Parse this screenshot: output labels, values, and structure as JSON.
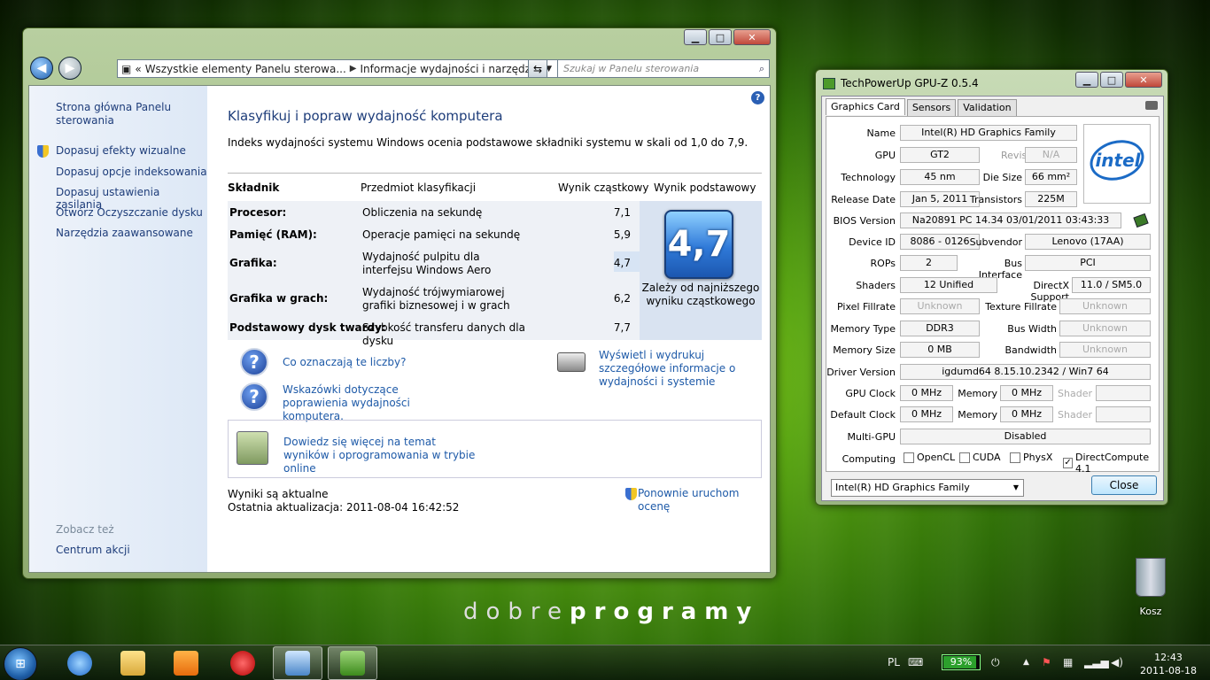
{
  "desktop": {
    "brand_light": "dobre",
    "brand_bold": "programy",
    "recycle_label": "Kosz"
  },
  "cp_window": {
    "address": {
      "prefix": "«",
      "crumb1": "Wszystkie elementy Panelu sterowa...",
      "crumb2": "Informacje wydajności i narzędzia"
    },
    "search_placeholder": "Szukaj w Panelu sterowania",
    "sidebar": {
      "home": "Strona główna Panelu sterowania",
      "items": [
        "Dopasuj efekty wizualne",
        "Dopasuj opcje indeksowania",
        "Dopasuj ustawienia zasilania",
        "Otwórz Oczyszczanie dysku",
        "Narzędzia zaawansowane"
      ],
      "see_also": "Zobacz też",
      "action_center": "Centrum akcji"
    },
    "main": {
      "title": "Klasyfikuj i popraw wydajność komputera",
      "description": "Indeks wydajności systemu Windows ocenia podstawowe składniki systemu w skali od 1,0 do 7,9.",
      "headers": [
        "Składnik",
        "Przedmiot klasyfikacji",
        "Wynik cząstkowy",
        "Wynik podstawowy"
      ],
      "rows": [
        {
          "component": "Procesor:",
          "rated": "Obliczenia na sekundę",
          "score": "7,1"
        },
        {
          "component": "Pamięć (RAM):",
          "rated": "Operacje pamięci na sekundę",
          "score": "5,9"
        },
        {
          "component": "Grafika:",
          "rated": "Wydajność pulpitu dla interfejsu Windows Aero",
          "score": "4,7"
        },
        {
          "component": "Grafika w grach:",
          "rated": "Wydajność trójwymiarowej grafiki biznesowej i w grach",
          "score": "6,2"
        },
        {
          "component": "Podstawowy dysk twardy:",
          "rated": "Szybkość transferu danych dla dysku",
          "score": "7,7"
        }
      ],
      "base_score": "4,7",
      "base_note": "Zależy od najniższego wyniku cząstkowego",
      "link_what": "Co oznaczają te liczby?",
      "link_tips": "Wskazówki dotyczące poprawienia wydajności komputera.",
      "link_print": "Wyświetl i wydrukuj szczegółowe informacje o wydajności i systemie",
      "link_online": "Dowiedz się więcej na temat wyników i oprogramowania w trybie online",
      "status_current": "Wyniki są aktualne",
      "status_last": "Ostatnia aktualizacja: 2011-08-04 16:42:52",
      "rerun": "Ponownie uruchom ocenę"
    }
  },
  "gpuz": {
    "title": "TechPowerUp GPU-Z 0.5.4",
    "tabs": [
      "Graphics Card",
      "Sensors",
      "Validation"
    ],
    "labels": {
      "name": "Name",
      "gpu": "GPU",
      "revision": "Revision",
      "technology": "Technology",
      "die_size": "Die Size",
      "release_date": "Release Date",
      "transistors": "Transistors",
      "bios": "BIOS Version",
      "device_id": "Device ID",
      "subvendor": "Subvendor",
      "rops": "ROPs",
      "bus_interface": "Bus Interface",
      "shaders": "Shaders",
      "directx": "DirectX Support",
      "pixel_fillrate": "Pixel Fillrate",
      "texture_fillrate": "Texture Fillrate",
      "memory_type": "Memory Type",
      "bus_width": "Bus Width",
      "memory_size": "Memory Size",
      "bandwidth": "Bandwidth",
      "driver": "Driver Version",
      "gpu_clock": "GPU Clock",
      "memory": "Memory",
      "shader": "Shader",
      "default_clock": "Default Clock",
      "multi_gpu": "Multi-GPU",
      "computing": "Computing"
    },
    "values": {
      "name": "Intel(R) HD Graphics Family",
      "gpu": "GT2",
      "revision": "N/A",
      "technology": "45 nm",
      "die_size": "66 mm²",
      "release_date": "Jan 5, 2011",
      "transistors": "225M",
      "bios": "Na20891 PC 14.34  03/01/2011  03:43:33",
      "device_id": "8086 - 0126",
      "subvendor": "Lenovo (17AA)",
      "rops": "2",
      "bus_interface": "PCI",
      "shaders": "12 Unified",
      "directx": "11.0 / SM5.0",
      "pixel_fillrate": "Unknown",
      "texture_fillrate": "Unknown",
      "memory_type": "DDR3",
      "bus_width": "Unknown",
      "memory_size": "0 MB",
      "bandwidth": "Unknown",
      "driver": "igdumd64 8.15.10.2342 / Win7 64",
      "gpu_clock": "0 MHz",
      "gpu_mem": "0 MHz",
      "def_clock": "0 MHz",
      "def_mem": "0 MHz",
      "multi_gpu": "Disabled"
    },
    "logo_text": "intel",
    "computing": [
      {
        "label": "OpenCL",
        "checked": ""
      },
      {
        "label": "CUDA",
        "checked": ""
      },
      {
        "label": "PhysX",
        "checked": ""
      },
      {
        "label": "DirectCompute 4.1",
        "checked": "✓"
      }
    ],
    "select_value": "Intel(R) HD Graphics Family",
    "close_label": "Close"
  },
  "taskbar": {
    "language": "PL",
    "battery_percent": "93%",
    "battery_level": 0.93,
    "time": "12:43",
    "date": "2011-08-18"
  }
}
